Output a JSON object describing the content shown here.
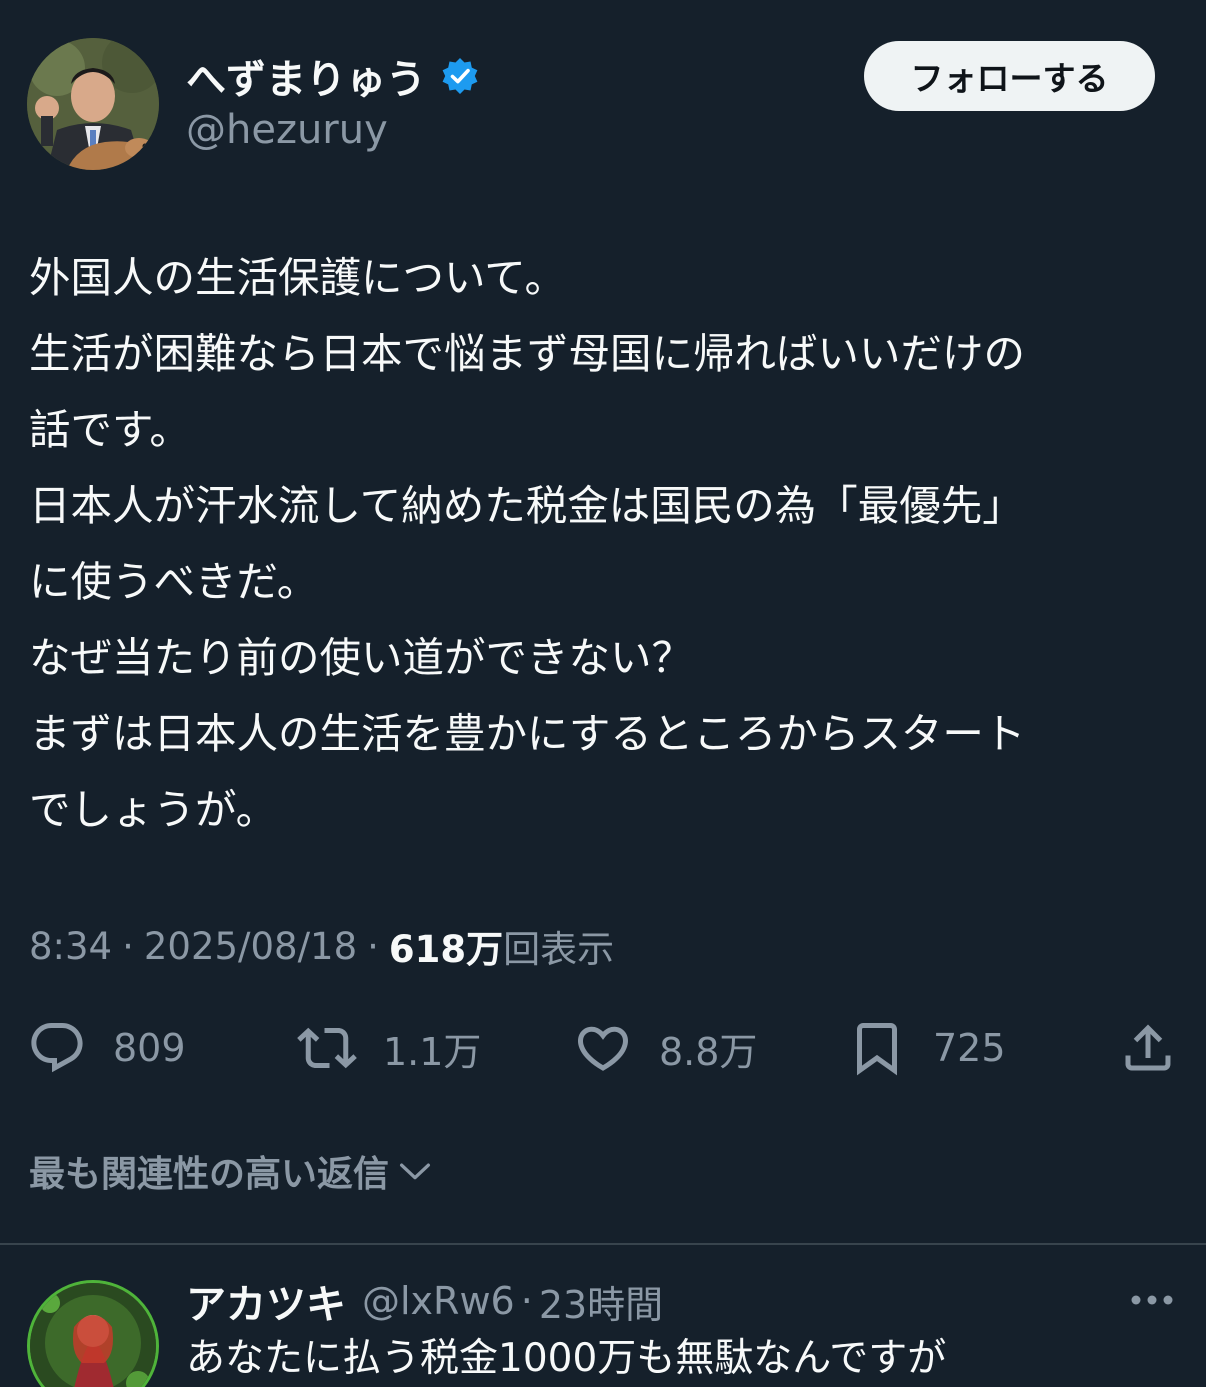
{
  "author": {
    "display_name": "へずまりゅう",
    "handle": "@hezuruy",
    "verified": true,
    "follow_label": "フォローする"
  },
  "tweet": {
    "lines": [
      "外国人の生活保護について。",
      "生活が困難なら日本で悩まず母国に帰ればいいだけの",
      "話です。",
      "日本人が汗水流して納めた税金は国民の為「最優先」",
      "に使うべきだ。",
      "なぜ当たり前の使い道ができない？",
      "まずは日本人の生活を豊かにするところからスタート",
      "でしょうが。"
    ],
    "time": "8:34",
    "date": "2025/08/18",
    "views_count": "618万",
    "views_label": "回表示"
  },
  "actions": {
    "reply_count": "809",
    "repost_count": "1.1万",
    "like_count": "8.8万",
    "bookmark_count": "725"
  },
  "replies_heading": "最も関連性の高い返信",
  "reply": {
    "display_name": "アカツキ",
    "handle": "@lxRw6",
    "time": "23時間",
    "text": "あなたに払う税金1000万も無駄なんですが"
  },
  "colors": {
    "background": "#15202b",
    "verified_blue": "#1d9bf0",
    "secondary_text": "#8b98a5",
    "follow_button_bg": "#eff3f4"
  }
}
